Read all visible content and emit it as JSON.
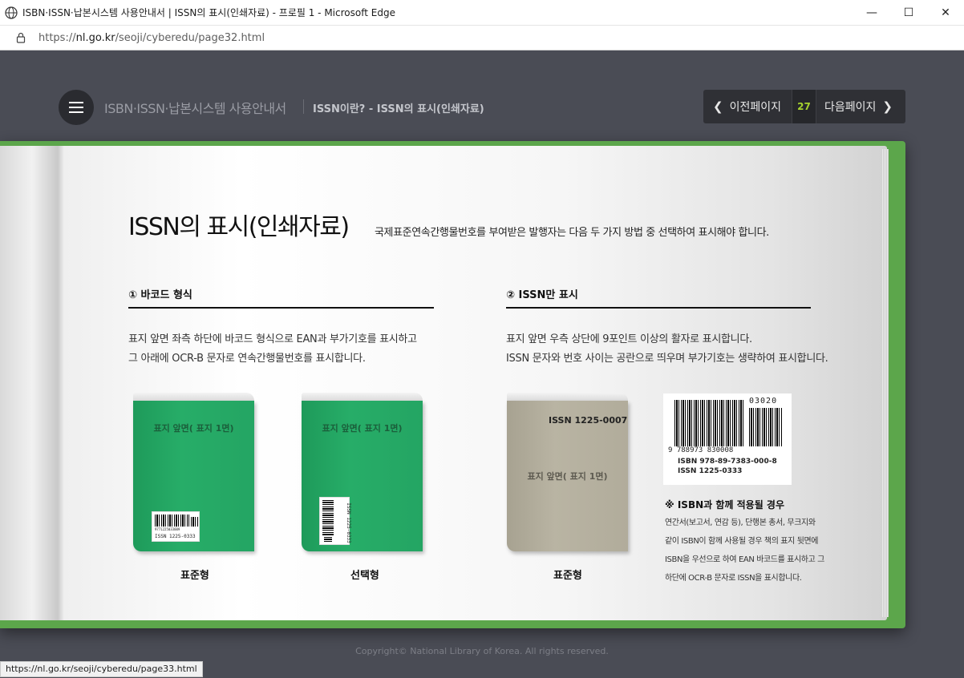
{
  "window": {
    "title": "ISBN·ISSN·납본시스템 사용안내서 | ISSN의 표시(인쇄자료) - 프로필 1 - Microsoft Edge",
    "minimize": "—",
    "maximize": "☐",
    "close": "✕"
  },
  "address": {
    "scheme": "https://",
    "host": "nl.go.kr",
    "path": "/seoji/cyberedu/page32.html"
  },
  "header": {
    "site_title": "ISBN·ISSN·납본시스템 사용안내서",
    "breadcrumb": "ISSN이란? - ISSN의 표시(인쇄자료)",
    "prev_label": "이전페이지",
    "page_number": "27",
    "next_label": "다음페이지"
  },
  "content": {
    "title": "ISSN의 표시(인쇄자료)",
    "description": "국제표준연속간행물번호를 부여받은 발행자는 다음 두 가지 방법 중 선택하여 표시해야 합니다.",
    "section1": {
      "title": "① 바코드 형식",
      "line1": "표지 앞면 좌측 하단에 바코드 형식으로 EAN과 부가기호를 표시하고",
      "line2": "그 아래에 OCR-B 문자로 연속간행물번호를 표시합니다."
    },
    "section2": {
      "title": "② ISSN만 표시",
      "line1": "표지 앞면 우측 상단에 9포인트 이상의 활자로 표시합니다.",
      "line2": "ISSN 문자와 번호 사이는 공란으로 띄우며 부가기호는 생략하여 표시합니다."
    },
    "book_label": "표지 앞면( 표지 1면)",
    "book1_caption": "표준형",
    "book2_caption": "선택형",
    "book3_caption": "표준형",
    "book3_issn": "ISSN 1225-0007",
    "small_barcode_digits": "9771225033009",
    "small_barcode_issn": "ISSN  1225-0333",
    "big_barcode": {
      "addon": "03020",
      "digits": "9  788973  830008",
      "isbn": "ISBN 978-89-7383-000-8",
      "issn": "ISSN 1225-0333"
    },
    "note_title": "※ ISBN과 함께 적용될 경우",
    "note_lines": [
      "연간서(보고서, 연감 등), 단행본 총서, 무크지와",
      "같이 ISBN이 함께 사용될 경우 책의 표지 뒷면에",
      "ISBN을 우선으로 하여 EAN 바코드를 표시하고 그",
      "하단에 OCR-B 문자로 ISSN을 표시합니다."
    ]
  },
  "footer": "Copyright© National Library of Korea. All rights reserved.",
  "status_url": "https://nl.go.kr/seoji/cyberedu/page33.html",
  "colors": {
    "book_green": "#27ad68",
    "cover_green": "#5ca64b",
    "page_num_accent": "#a6d22e",
    "background": "#4a4c55"
  }
}
